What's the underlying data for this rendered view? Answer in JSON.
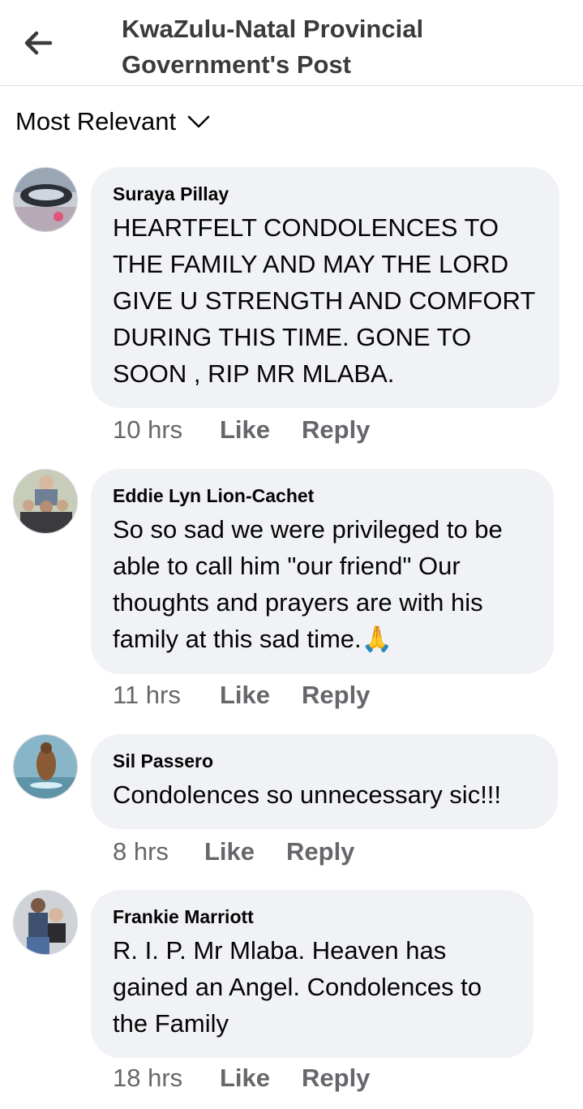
{
  "header": {
    "title": "KwaZulu-Natal Provincial Government's Post",
    "back_icon": "back-arrow-icon"
  },
  "sort": {
    "label": "Most Relevant",
    "icon": "chevron-down-icon"
  },
  "comments": [
    {
      "author": "Suraya Pillay",
      "text": "HEARTFELT CONDOLENCES TO THE FAMILY AND MAY THE LORD GIVE U STRENGTH AND COMFORT DURING THIS TIME.  GONE TO SOON , RIP MR MLABA.",
      "time": "10 hrs",
      "like": "Like",
      "reply": "Reply"
    },
    {
      "author": "Eddie Lyn Lion-Cachet",
      "text": "So so sad we were privileged to be able to call him \"our friend\"  Our thoughts and prayers are with his family at this sad time.",
      "emoji": "🙏",
      "time": "11 hrs",
      "like": "Like",
      "reply": "Reply"
    },
    {
      "author": "Sil Passero",
      "text": "Condolences so unnecessary sic!!!",
      "time": "8 hrs",
      "like": "Like",
      "reply": "Reply"
    },
    {
      "author": "Frankie Marriott",
      "text": "R. I. P. Mr Mlaba. Heaven has gained an Angel. Condolences to the Family",
      "time": "18 hrs",
      "like": "Like",
      "reply": "Reply"
    }
  ],
  "colors": {
    "bubble": "#f0f2f5",
    "secondary_text": "#65676b",
    "primary_text": "#050505"
  }
}
